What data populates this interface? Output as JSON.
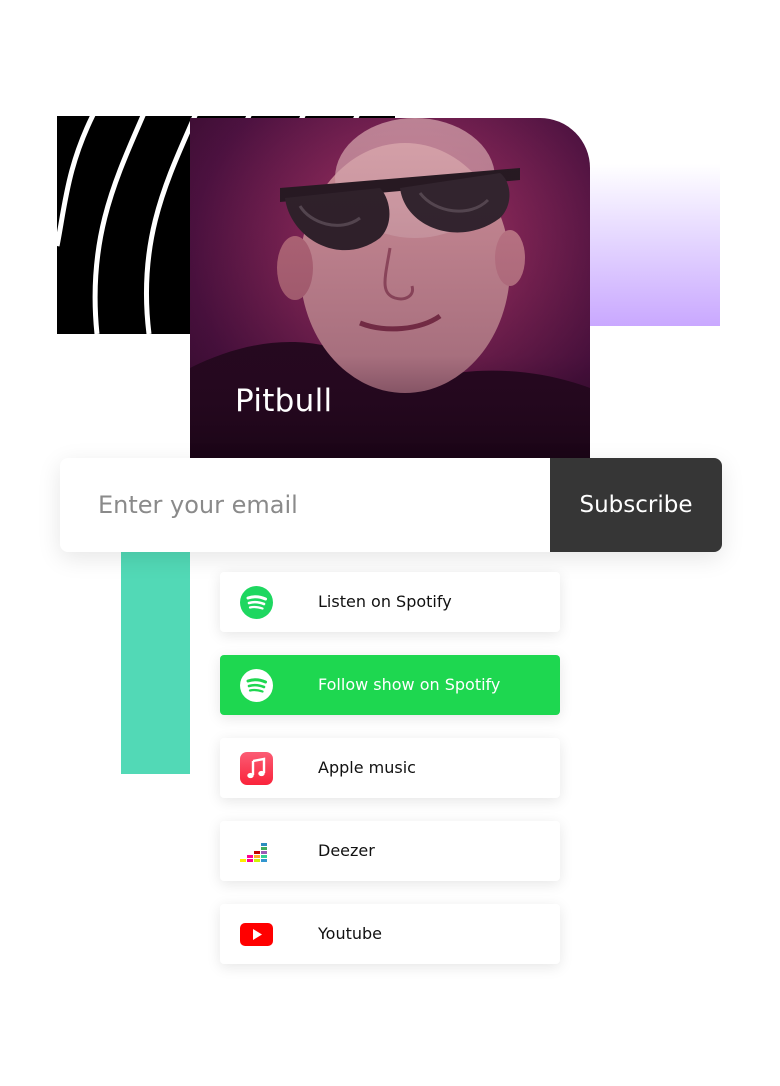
{
  "artist": {
    "name": "Pitbull"
  },
  "subscribe": {
    "email_placeholder": "Enter your email",
    "button_label": "Subscribe"
  },
  "links": [
    {
      "label": "Listen on Spotify",
      "icon": "spotify-icon",
      "style": "white"
    },
    {
      "label": "Follow show on Spotify",
      "icon": "spotify-icon",
      "style": "green"
    },
    {
      "label": "Apple music",
      "icon": "apple-music-icon",
      "style": "white"
    },
    {
      "label": "Deezer",
      "icon": "deezer-icon",
      "style": "white"
    },
    {
      "label": "Youtube",
      "icon": "youtube-icon",
      "style": "white"
    }
  ],
  "colors": {
    "spotify_green": "#1ed750",
    "teal_accent": "#52d9b6",
    "purple_accent": "#c9a8ff",
    "subscribe_bg": "#363636"
  }
}
